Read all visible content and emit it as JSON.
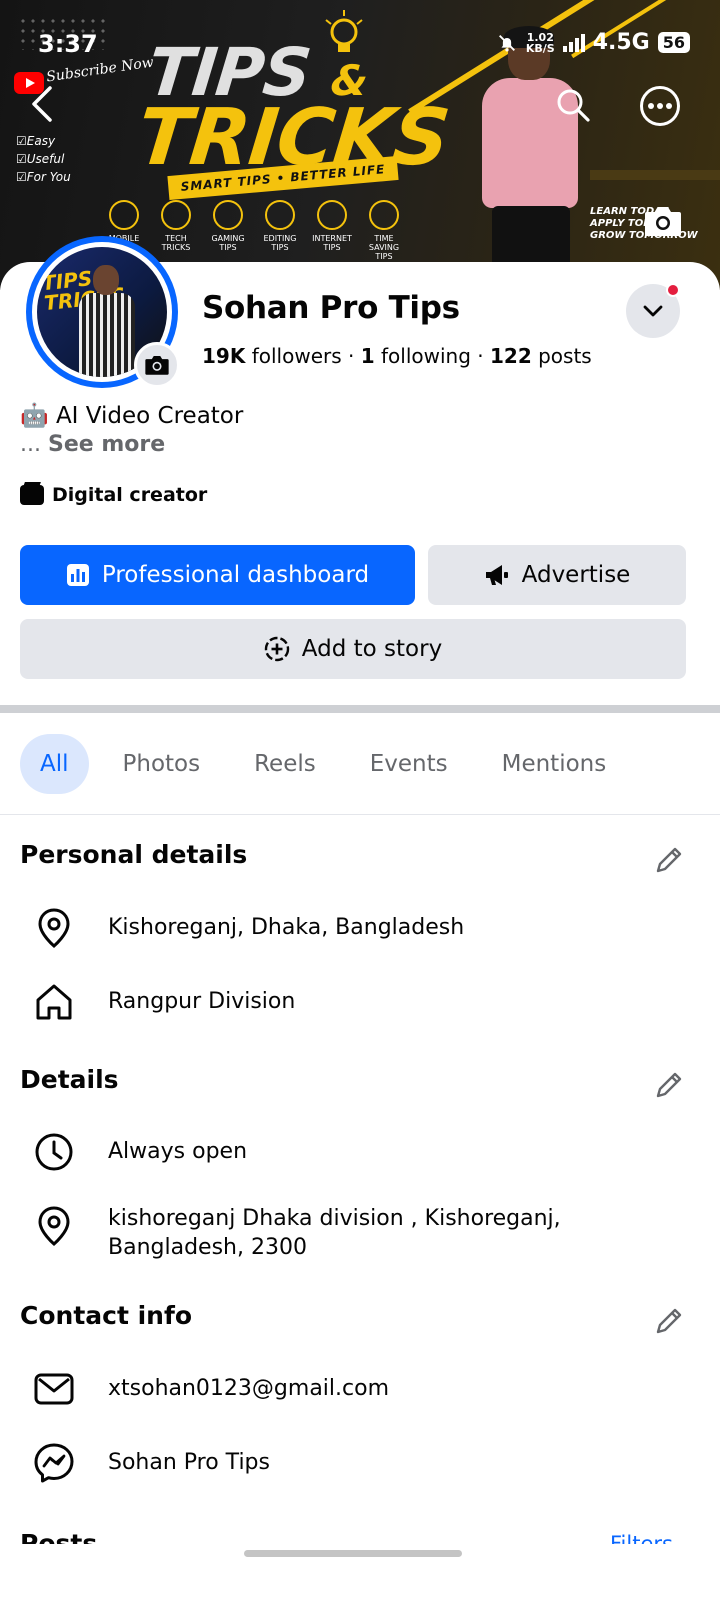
{
  "status_bar": {
    "time": "3:37",
    "speed_value": "1.02",
    "speed_unit": "KB/S",
    "network": "4.5G",
    "battery": "56"
  },
  "cover": {
    "subscribe": "Subscribe Now",
    "checklist": [
      "Easy",
      "Useful",
      "For You"
    ],
    "title_line1": "TIPS",
    "title_amp": "&",
    "title_line2": "TRICKS",
    "banner": "SMART TIPS • BETTER LIFE",
    "categories": [
      "MOBILE TIPS",
      "TECH TRICKS",
      "GAMING TIPS",
      "EDITING TIPS",
      "INTERNET TIPS",
      "TIME SAVING TIPS"
    ],
    "learn_lines": [
      "LEARN TODAY",
      "APPLY TODAY",
      "GROW TOMORROW"
    ]
  },
  "profile": {
    "name": "Sohan Pro Tips",
    "followers_count": "19K",
    "followers_label": "followers",
    "following_count": "1",
    "following_label": "following",
    "posts_count": "122",
    "posts_label": "posts",
    "bio_emoji": "🤖",
    "bio": "AI Video Creator",
    "see_more_prefix": "...",
    "see_more": "See more",
    "category": "Digital creator"
  },
  "actions": {
    "professional_dashboard": "Professional dashboard",
    "advertise": "Advertise",
    "add_to_story": "Add to story"
  },
  "tabs": [
    "All",
    "Photos",
    "Reels",
    "Events",
    "Mentions"
  ],
  "active_tab": "All",
  "personal_details": {
    "title": "Personal details",
    "location": "Kishoreganj, Dhaka, Bangladesh",
    "hometown": "Rangpur Division"
  },
  "details": {
    "title": "Details",
    "hours": "Always open",
    "address_line1": "kishoreganj Dhaka division , Kishoreganj,",
    "address_line2": "Bangladesh, 2300"
  },
  "contact_info": {
    "title": "Contact info",
    "email": "xtsohan0123@gmail.com",
    "messenger": "Sohan Pro Tips"
  },
  "posts_section": {
    "title": "Posts",
    "filters": "Filters"
  },
  "colors": {
    "accent": "#0866ff",
    "secondary_button": "#e4e6eb",
    "notification_dot": "#e41e3f",
    "cover_yellow": "#f4c20d"
  }
}
